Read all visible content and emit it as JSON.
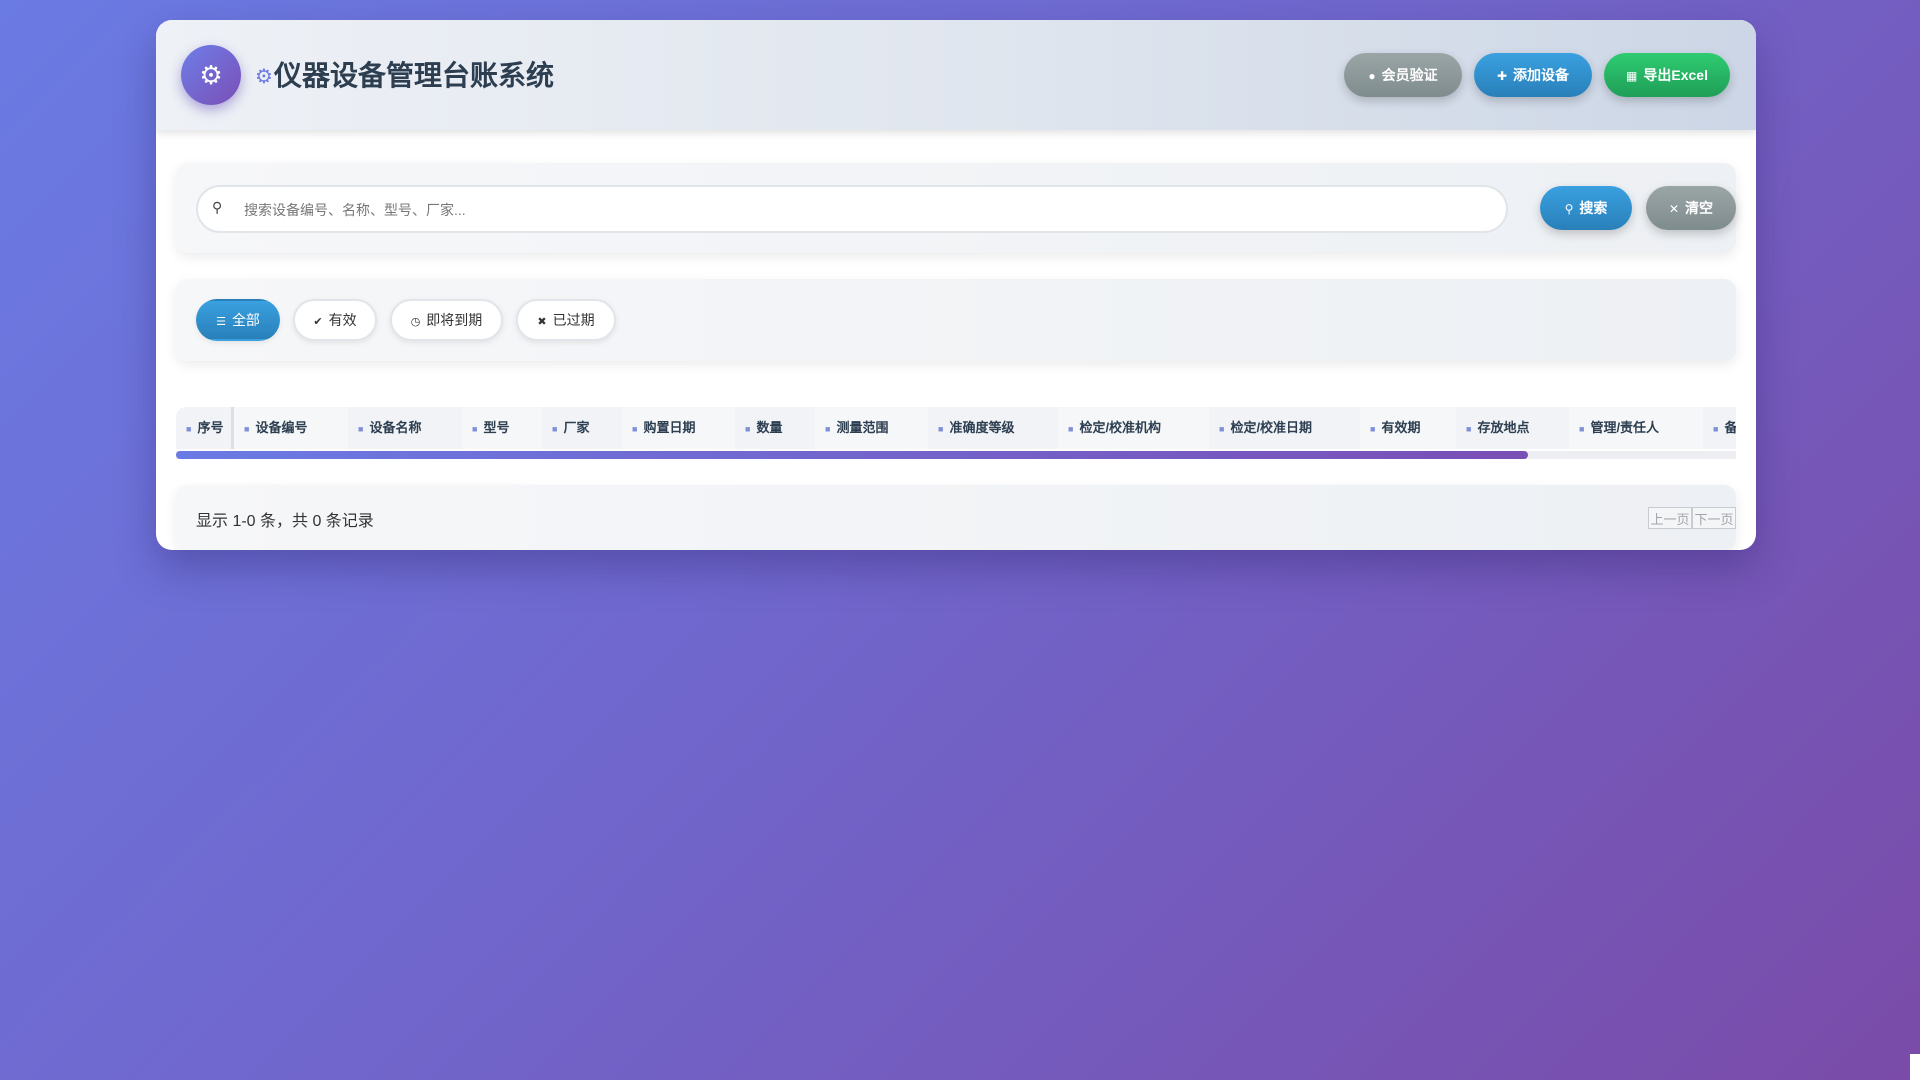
{
  "header": {
    "logo_icon": "toolbox-icon",
    "title_icon": "gear-icon",
    "title": "仪器设备管理台账系统",
    "buttons": {
      "member": "会员验证",
      "add": "添加设备",
      "export": "导出Excel"
    },
    "colors": {
      "member": "#7f8c8d",
      "add": "#2980b9",
      "export": "#27ae60"
    }
  },
  "search": {
    "placeholder": "搜索设备编号、名称、型号、厂家...",
    "value": "",
    "search_label": "搜索",
    "clear_label": "清空"
  },
  "filters": {
    "all": "全部",
    "valid": "有效",
    "expiring": "即将到期",
    "expired": "已过期",
    "active": "全部"
  },
  "table": {
    "columns": [
      "序号",
      "设备编号",
      "设备名称",
      "型号",
      "厂家",
      "购置日期",
      "数量",
      "测量范围",
      "准确度等级",
      "检定/校准机构",
      "检定/校准日期",
      "有效期",
      "存放地点",
      "管理/责任人",
      "备"
    ],
    "rows": []
  },
  "pagination": {
    "info": "显示 1-0 条，共 0 条记录",
    "prev": "上一页",
    "next": "下一页"
  }
}
